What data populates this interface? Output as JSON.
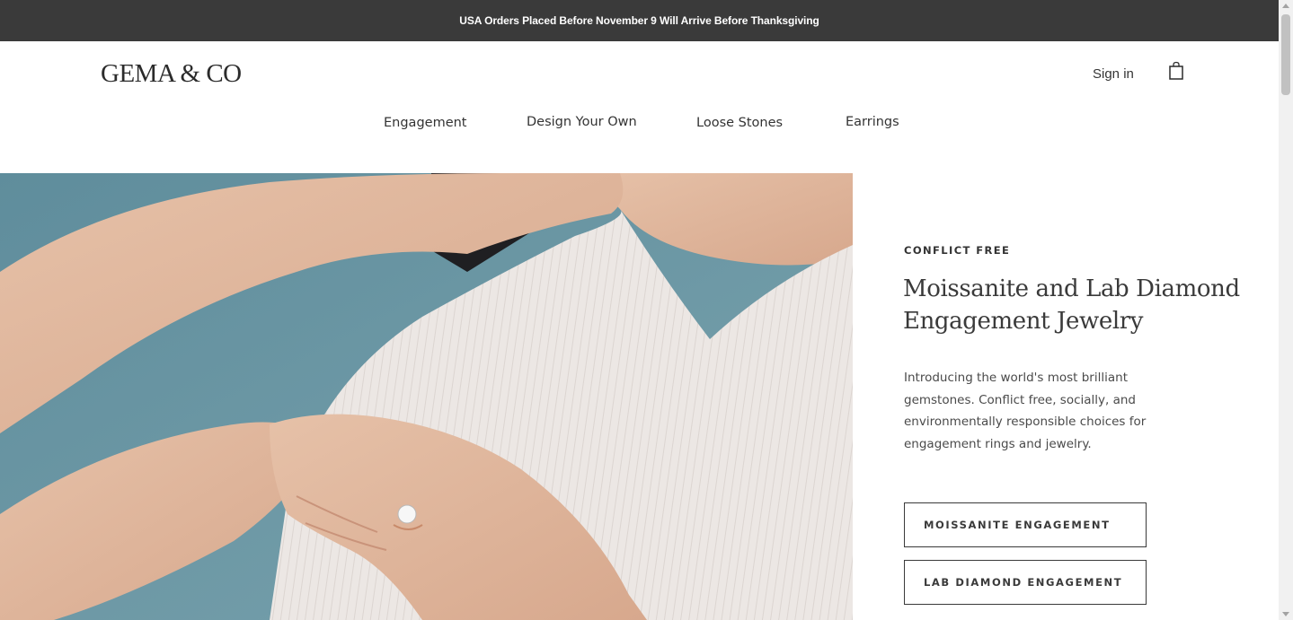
{
  "announcement": "USA Orders Placed Before November 9 Will Arrive Before Thanksgiving",
  "header": {
    "logo": "GEMA & CO",
    "sign_in": "Sign in",
    "cart_icon": "shopping-bag-icon"
  },
  "nav": {
    "items": [
      "Engagement",
      "Design Your Own",
      "Loose Stones",
      "Earrings"
    ]
  },
  "hero": {
    "eyebrow": "CONFLICT FREE",
    "headline_line1": "Moissanite and Lab Diamond",
    "headline_line2": "Engagement Jewelry",
    "body": "Introducing the world's most brilliant gemstones. Conflict free, socially, and environmentally responsible choices for engagement rings and jewelry.",
    "buttons": [
      "MOISSANITE ENGAGEMENT",
      "LAB DIAMOND ENGAGEMENT"
    ]
  },
  "colors": {
    "announcement_bg": "#3a3a3a",
    "text": "#333333",
    "hero_backdrop": "#6e9aa8",
    "blouse": "#ece7e4"
  }
}
